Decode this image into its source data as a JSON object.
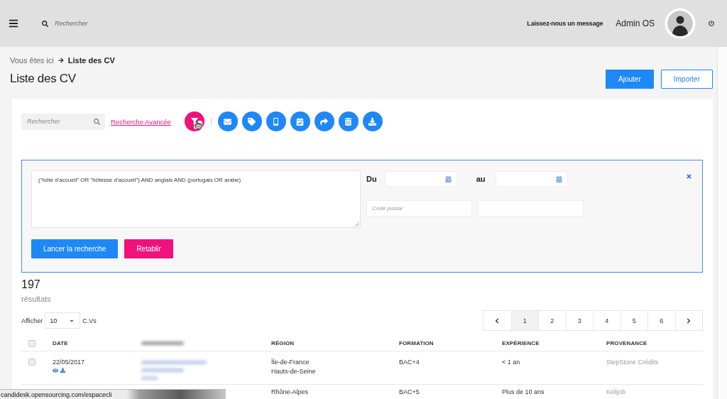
{
  "header": {
    "search": {
      "placeholder": "Rechercher"
    },
    "message_link": "Laissez-nous un message",
    "user_name": "Admin OS"
  },
  "breadcrumb": {
    "prefix": "Vous êtes ici",
    "current": "Liste des CV"
  },
  "page_title": "Liste des CV",
  "page_actions": [
    {
      "label": "Ajouter",
      "kind": "primary"
    },
    {
      "label": "Importer",
      "kind": "outline"
    }
  ],
  "toolbar": {
    "search": {
      "placeholder": "Rechercher"
    },
    "advanced_link": "Recherche Avancée"
  },
  "advanced_search": {
    "expanded": true,
    "query": "(\"hôte d'accueil\" OR \"hôtesse d'accueil\") AND anglais AND (portugais OR arabe)",
    "date_from_label": "Du",
    "date_to_label": "au",
    "postal_code": {
      "placeholder": "Code postal"
    },
    "buttons": [
      {
        "label": "Lancer la recherche",
        "kind": "primary"
      },
      {
        "label": "Retablir",
        "kind": "reset"
      }
    ]
  },
  "results": {
    "count": "197",
    "label": "résultats"
  },
  "page_size": {
    "prefix": "Afficher",
    "value": "10",
    "suffix": "C.Vs"
  },
  "pagination": {
    "pages": [
      {
        "label": "1",
        "selected": true
      },
      {
        "label": "2",
        "selected": false
      },
      {
        "label": "3",
        "selected": false
      },
      {
        "label": "4",
        "selected": false
      },
      {
        "label": "5",
        "selected": false
      },
      {
        "label": "6",
        "selected": false
      }
    ]
  },
  "table": {
    "select_all": {
      "checked": false
    },
    "columns": [
      {
        "kind": "text",
        "label": "DATE"
      },
      {
        "kind": "blurred"
      },
      {
        "kind": "text",
        "label": "RÉGION"
      },
      {
        "kind": "text",
        "label": "FORMATION"
      },
      {
        "kind": "text",
        "label": "EXPÉRIENCE"
      },
      {
        "kind": "text",
        "label": "PROVENANCE"
      }
    ],
    "rows": [
      {
        "checked": false,
        "date": "22/05/2017",
        "redacted": true,
        "region": "Île-de-France",
        "department": "Hauts-de-Seine",
        "formation": "BAC+4",
        "experience": "< 1 an",
        "provenance": "StepStone Crédits"
      },
      {
        "region": "Rhône-Alpes",
        "formation": "BAC+5",
        "experience": "Plus de 10 ans",
        "provenance": "Kelijob"
      }
    ]
  },
  "browser_status": {
    "url": "candidesk.opensourcing.com/espacecli"
  }
}
